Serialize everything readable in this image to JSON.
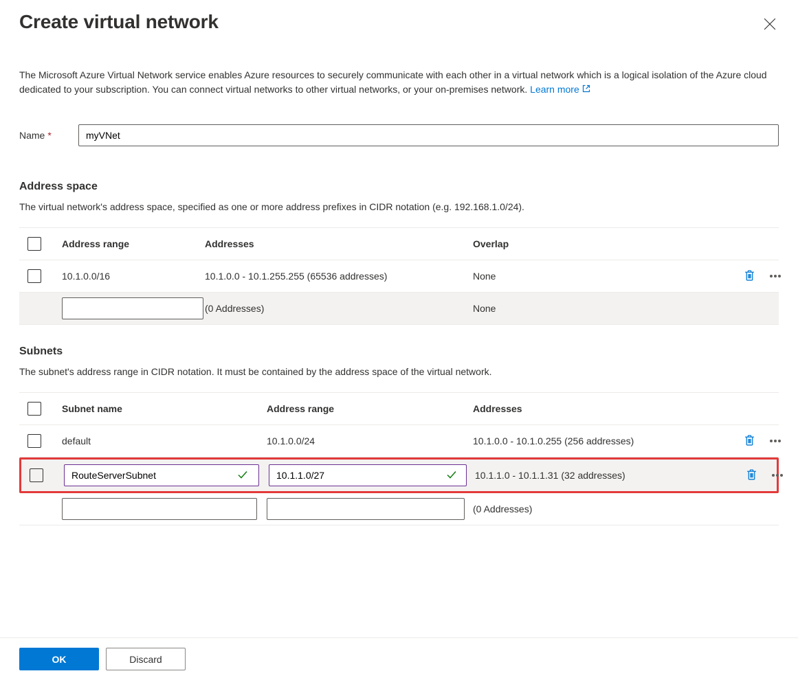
{
  "header": {
    "title": "Create virtual network"
  },
  "description": {
    "text": "The Microsoft Azure Virtual Network service enables Azure resources to securely communicate with each other in a virtual network which is a logical isolation of the Azure cloud dedicated to your subscription. You can connect virtual networks to other virtual networks, or your on-premises network. ",
    "learn_more": "Learn more"
  },
  "name_field": {
    "label": "Name",
    "value": "myVNet"
  },
  "address_space": {
    "heading": "Address space",
    "description": "The virtual network's address space, specified as one or more address prefixes in CIDR notation (e.g. 192.168.1.0/24).",
    "columns": {
      "range": "Address range",
      "addresses": "Addresses",
      "overlap": "Overlap"
    },
    "rows": [
      {
        "range": "10.1.0.0/16",
        "addresses": "10.1.0.0 - 10.1.255.255 (65536 addresses)",
        "overlap": "None",
        "editable": false,
        "has_actions": true
      },
      {
        "range": "",
        "addresses": "(0 Addresses)",
        "overlap": "None",
        "editable": true,
        "has_actions": false
      }
    ]
  },
  "subnets": {
    "heading": "Subnets",
    "description": "The subnet's address range in CIDR notation. It must be contained by the address space of the virtual network.",
    "columns": {
      "name": "Subnet name",
      "range": "Address range",
      "addresses": "Addresses"
    },
    "rows": [
      {
        "name": "default",
        "range": "10.1.0.0/24",
        "addresses": "10.1.0.0 - 10.1.0.255 (256 addresses)",
        "editable": false,
        "highlighted": false,
        "valid": false
      },
      {
        "name": "RouteServerSubnet",
        "range": "10.1.1.0/27",
        "addresses": "10.1.1.0 - 10.1.1.31 (32 addresses)",
        "editable": true,
        "highlighted": true,
        "valid": true
      },
      {
        "name": "",
        "range": "",
        "addresses": "(0 Addresses)",
        "editable": true,
        "highlighted": false,
        "valid": false
      }
    ]
  },
  "footer": {
    "ok": "OK",
    "discard": "Discard"
  }
}
